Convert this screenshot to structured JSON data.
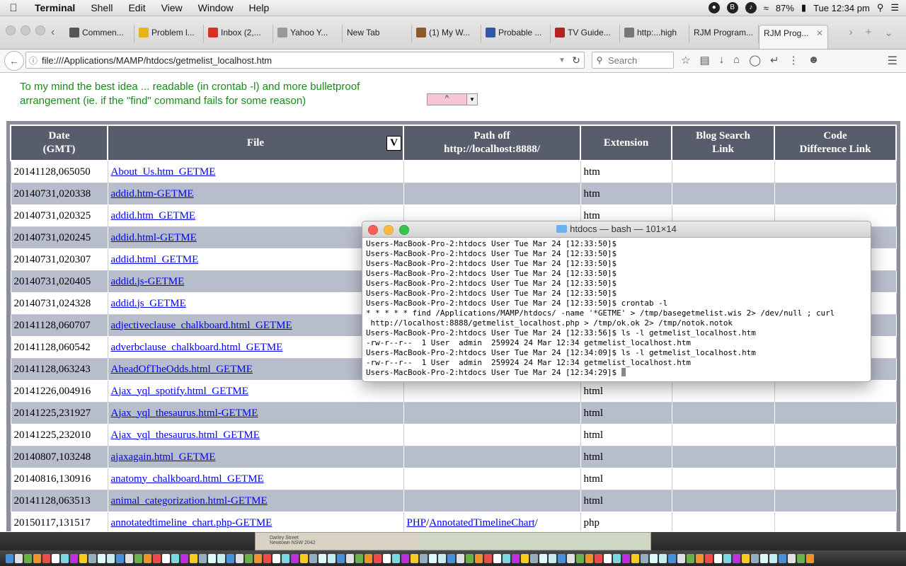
{
  "menubar": {
    "app": "Terminal",
    "items": [
      "Shell",
      "Edit",
      "View",
      "Window",
      "Help"
    ],
    "battery": "87%",
    "clock": "Tue 12:34 pm"
  },
  "browser": {
    "tabs": [
      {
        "label": "Commen...",
        "color": "#555"
      },
      {
        "label": "Problem l...",
        "color": "#e7b416"
      },
      {
        "label": "Inbox (2,...",
        "color": "#d93025"
      },
      {
        "label": "Yahoo Y...",
        "color": "#999"
      },
      {
        "label": "New Tab",
        "color": ""
      },
      {
        "label": "(1) My W...",
        "color": "#8a5a2b"
      },
      {
        "label": "Probable ...",
        "color": "#3355aa"
      },
      {
        "label": "TV Guide...",
        "color": "#b22222"
      },
      {
        "label": "http:...high",
        "color": "#777"
      },
      {
        "label": "RJM Program...",
        "color": ""
      },
      {
        "label": "RJM Prog...",
        "color": ""
      }
    ],
    "url": "file:///Applications/MAMP/htdocs/getmelist_localhost.htm",
    "search_placeholder": "Search"
  },
  "page": {
    "intro": "To my mind the best idea ... readable (in crontab -l) and more bulletproof arrangement (ie. if the \"find\" command fails for some reason)",
    "sort_select": "^",
    "sort_checkbox": "V",
    "headers": {
      "date_line1": "Date",
      "date_line2": "(GMT)",
      "file": "File",
      "path_line1": "Path off",
      "path_line2": "http://localhost:8888/",
      "extension": "Extension",
      "blog_line1": "Blog Search",
      "blog_line2": "Link",
      "code_line1": "Code",
      "code_line2": "Difference Link"
    },
    "rows": [
      {
        "date": "20141128,065050",
        "file": "About_Us.htm_GETME",
        "path1": "",
        "path2": "",
        "ext": "htm"
      },
      {
        "date": "20140731,020338",
        "file": "addid.htm-GETME",
        "path1": "",
        "path2": "",
        "ext": "htm"
      },
      {
        "date": "20140731,020325",
        "file": "addid.htm_GETME",
        "path1": "",
        "path2": "",
        "ext": "htm"
      },
      {
        "date": "20140731,020245",
        "file": "addid.html-GETME",
        "path1": "",
        "path2": "",
        "ext": ""
      },
      {
        "date": "20140731,020307",
        "file": "addid.html_GETME",
        "path1": "",
        "path2": "",
        "ext": ""
      },
      {
        "date": "20140731,020405",
        "file": "addid.js-GETME",
        "path1": "",
        "path2": "",
        "ext": ""
      },
      {
        "date": "20140731,024328",
        "file": "addid.js_GETME",
        "path1": "",
        "path2": "",
        "ext": ""
      },
      {
        "date": "20141128,060707",
        "file": "adjectiveclause_chalkboard.html_GETME",
        "path1": "",
        "path2": "",
        "ext": ""
      },
      {
        "date": "20141128,060542",
        "file": "adverbclause_chalkboard.html_GETME",
        "path1": "",
        "path2": "",
        "ext": ""
      },
      {
        "date": "20141128,063243",
        "file": "AheadOfTheOdds.html_GETME",
        "path1": "",
        "path2": "",
        "ext": ""
      },
      {
        "date": "20141226,004916",
        "file": "Ajax_yql_spotify.html_GETME",
        "path1": "",
        "path2": "",
        "ext": "html"
      },
      {
        "date": "20141225,231927",
        "file": "Ajax_yql_thesaurus.html-GETME",
        "path1": "",
        "path2": "",
        "ext": "html"
      },
      {
        "date": "20141225,232010",
        "file": "Ajax_yql_thesaurus.html_GETME",
        "path1": "",
        "path2": "",
        "ext": "html"
      },
      {
        "date": "20140807,103248",
        "file": "ajaxagain.html_GETME",
        "path1": "",
        "path2": "",
        "ext": "html"
      },
      {
        "date": "20140816,130916",
        "file": "anatomy_chalkboard.html_GETME",
        "path1": "",
        "path2": "",
        "ext": "html"
      },
      {
        "date": "20141128,063513",
        "file": "animal_categorization.html-GETME",
        "path1": "",
        "path2": "",
        "ext": "html"
      },
      {
        "date": "20150117,131517",
        "file": "annotatedtimeline_chart.php-GETME",
        "path1": "PHP",
        "path2": "AnnotatedTimelineChart",
        "ext": "php"
      }
    ]
  },
  "terminal": {
    "title": "htdocs — bash — 101×14",
    "lines": [
      "Users-MacBook-Pro-2:htdocs User Tue Mar 24 [12:33:50]$",
      "Users-MacBook-Pro-2:htdocs User Tue Mar 24 [12:33:50]$",
      "Users-MacBook-Pro-2:htdocs User Tue Mar 24 [12:33:50]$",
      "Users-MacBook-Pro-2:htdocs User Tue Mar 24 [12:33:50]$",
      "Users-MacBook-Pro-2:htdocs User Tue Mar 24 [12:33:50]$",
      "Users-MacBook-Pro-2:htdocs User Tue Mar 24 [12:33:50]$",
      "Users-MacBook-Pro-2:htdocs User Tue Mar 24 [12:33:50]$ crontab -l",
      "* * * * * find /Applications/MAMP/htdocs/ -name '*GETME' > /tmp/basegetmelist.wis 2> /dev/null ; curl",
      " http://localhost:8888/getmelist_localhost.php > /tmp/ok.ok 2> /tmp/notok.notok",
      "Users-MacBook-Pro-2:htdocs User Tue Mar 24 [12:33:56]$ ls -l getmelist_localhost.htm",
      "-rw-r--r--  1 User  admin  259924 24 Mar 12:34 getmelist_localhost.htm",
      "Users-MacBook-Pro-2:htdocs User Tue Mar 24 [12:34:09]$ ls -l getmelist_localhost.htm",
      "-rw-r--r--  1 User  admin  259924 24 Mar 12:34 getmelist_localhost.htm",
      "Users-MacBook-Pro-2:htdocs User Tue Mar 24 [12:34:29]$ "
    ]
  },
  "dock_preview": {
    "address_line1": "Darley Street",
    "address_line2": "Newtown NSW 2042"
  },
  "colors": {
    "header_bg": "#575d6b",
    "row_alt": "#b8bdcc",
    "intro_text": "#1a8a1a",
    "link": "#0000ee"
  }
}
